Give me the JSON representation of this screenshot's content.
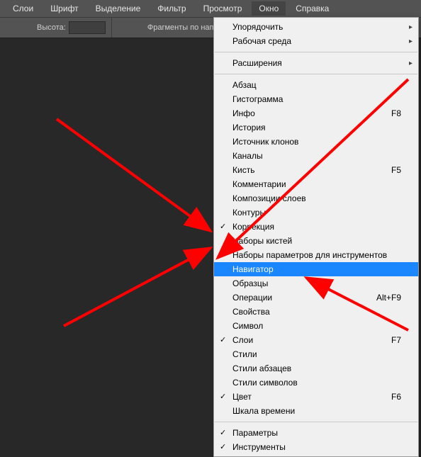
{
  "menubar": {
    "items": [
      {
        "label": "Слои",
        "active": false
      },
      {
        "label": "Шрифт",
        "active": false
      },
      {
        "label": "Выделение",
        "active": false
      },
      {
        "label": "Фильтр",
        "active": false
      },
      {
        "label": "Просмотр",
        "active": false
      },
      {
        "label": "Окно",
        "active": true
      },
      {
        "label": "Справка",
        "active": false
      }
    ]
  },
  "toolbar": {
    "height_label": "Высота:",
    "height_value": "",
    "fragments_label": "Фрагменты по направлени"
  },
  "dropdown": {
    "groups": [
      [
        {
          "label": "Упорядочить",
          "submenu": true
        },
        {
          "label": "Рабочая среда",
          "submenu": true
        }
      ],
      [
        {
          "label": "Расширения",
          "submenu": true
        }
      ],
      [
        {
          "label": "Абзац"
        },
        {
          "label": "Гистограмма"
        },
        {
          "label": "Инфо",
          "shortcut": "F8"
        },
        {
          "label": "История"
        },
        {
          "label": "Источник клонов"
        },
        {
          "label": "Каналы"
        },
        {
          "label": "Кисть",
          "shortcut": "F5"
        },
        {
          "label": "Комментарии"
        },
        {
          "label": "Композиции слоев"
        },
        {
          "label": "Контуры"
        },
        {
          "label": "Коррекция",
          "checked": true
        },
        {
          "label": "Наборы кистей"
        },
        {
          "label": "Наборы параметров для инструментов"
        },
        {
          "label": "Навигатор",
          "highlight": true
        },
        {
          "label": "Образцы"
        },
        {
          "label": "Операции",
          "shortcut": "Alt+F9"
        },
        {
          "label": "Свойства"
        },
        {
          "label": "Символ"
        },
        {
          "label": "Слои",
          "shortcut": "F7",
          "checked": true
        },
        {
          "label": "Стили"
        },
        {
          "label": "Стили абзацев"
        },
        {
          "label": "Стили символов"
        },
        {
          "label": "Цвет",
          "shortcut": "F6",
          "checked": true
        },
        {
          "label": "Шкала времени"
        }
      ],
      [
        {
          "label": "Параметры",
          "checked": true
        },
        {
          "label": "Инструменты",
          "checked": true
        }
      ]
    ]
  },
  "colors": {
    "menubar_bg": "#535353",
    "canvas_bg": "#282828",
    "dropdown_bg": "#f0f0f0",
    "highlight_bg": "#1a86ff",
    "annotation_arrow": "#ff0000"
  }
}
